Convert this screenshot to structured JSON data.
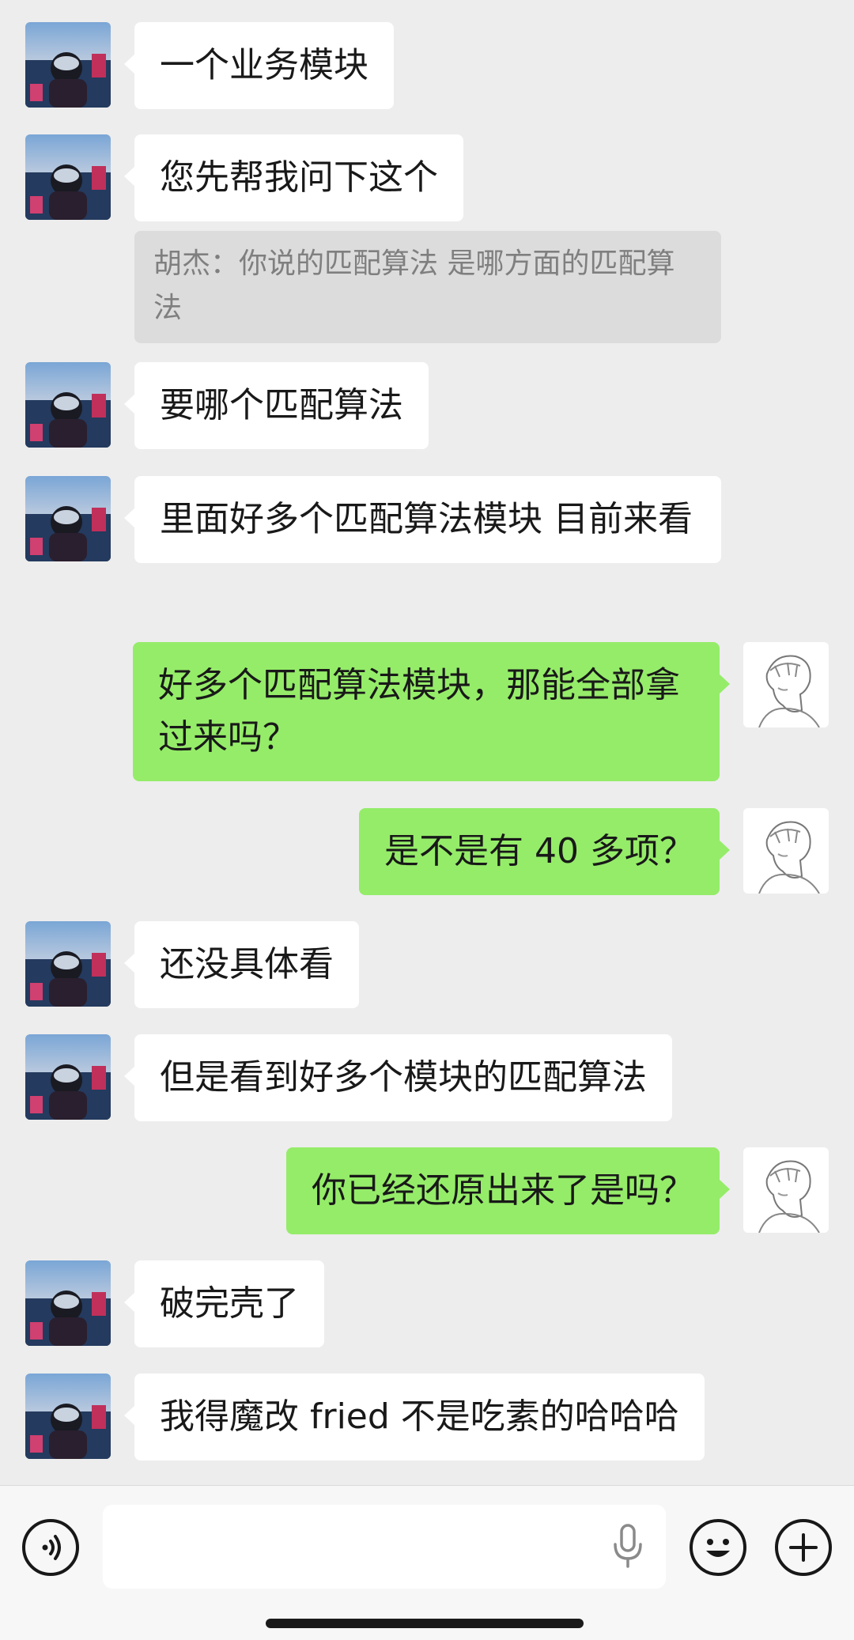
{
  "conversation": {
    "msg1": "一个业务模块",
    "msg2": "您先帮我问下这个",
    "quote": "胡杰：你说的匹配算法 是哪方面的匹配算法",
    "msg3": "要哪个匹配算法",
    "msg4": "里面好多个匹配算法模块 目前来看",
    "msg5": "好多个匹配算法模块，那能全部拿过来吗？",
    "msg6": "是不是有 40 多项？",
    "msg7": "还没具体看",
    "msg8": "但是看到好多个模块的匹配算法",
    "msg9": "你已经还原出来了是吗？",
    "msg10": "破完壳了",
    "msg11": "我得魔改 fried 不是吃素的哈哈哈"
  },
  "input": {
    "value": "",
    "placeholder": ""
  },
  "icons": {
    "voice": "voice-mode-icon",
    "mic": "microphone-icon",
    "emoji": "emoji-icon",
    "plus": "plus-icon"
  },
  "colors": {
    "background": "#ededed",
    "incoming_bubble": "#ffffff",
    "outgoing_bubble": "#95ec69",
    "quote_bg": "#dcdcdc"
  }
}
